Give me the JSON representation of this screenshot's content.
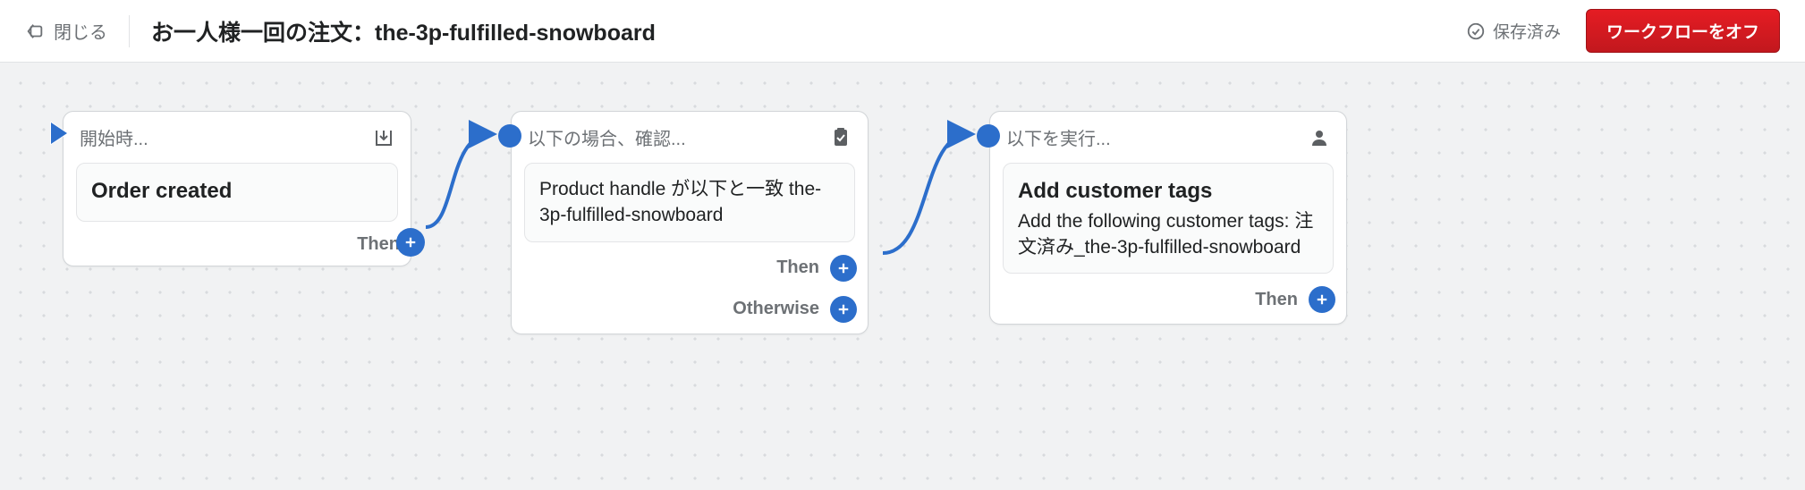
{
  "header": {
    "close_label": "閉じる",
    "title": "お一人様一回の注文：the-3p-fulfilled-snowboard",
    "saved_label": "保存済み",
    "turn_off_label": "ワークフローをオフ"
  },
  "cards": {
    "trigger": {
      "header_label": "開始時...",
      "body_title": "Order created",
      "then_label": "Then"
    },
    "condition": {
      "header_label": "以下の場合、確認...",
      "body_text": "Product handle が以下と一致 the-3p-fulfilled-snowboard",
      "then_label": "Then",
      "otherwise_label": "Otherwise"
    },
    "action": {
      "header_label": "以下を実行...",
      "body_title": "Add customer tags",
      "body_text": "Add the following customer tags: 注文済み_the-3p-fulfilled-snowboard",
      "then_label": "Then"
    }
  }
}
